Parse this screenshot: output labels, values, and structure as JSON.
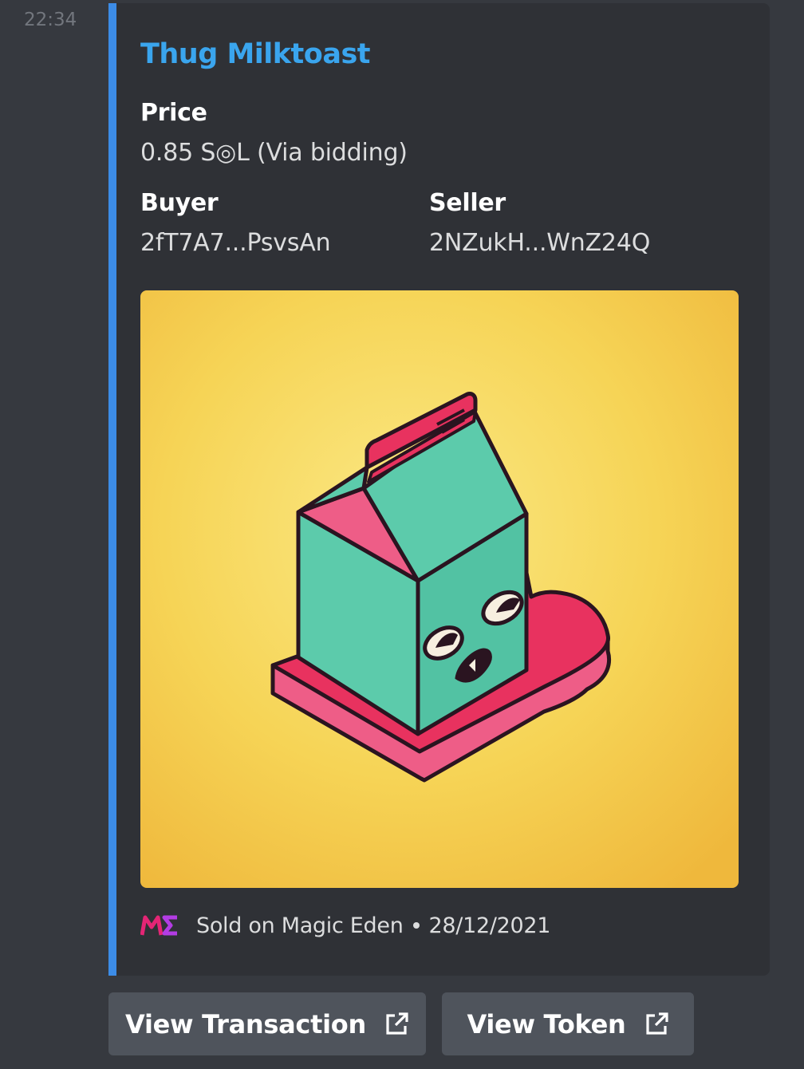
{
  "message": {
    "timestamp": "22:34"
  },
  "embed": {
    "accent_color": "#3c8ce7",
    "title": "Thug Milktoast",
    "title_color": "#3aa5ee",
    "fields": {
      "price": {
        "name": "Price",
        "value": "0.85 S◎L (Via bidding)"
      },
      "buyer": {
        "name": "Buyer",
        "value": "2fT7A7...PsvsAn"
      },
      "seller": {
        "name": "Seller",
        "value": "2NZukH...WnZ24Q"
      }
    },
    "image": {
      "description_icon": "milk-carton-nft-image",
      "background": "#f3c748"
    },
    "footer": {
      "icon": "magic-eden-logo-icon",
      "text": "Sold on Magic Eden",
      "date": "28/12/2021"
    }
  },
  "buttons": {
    "view_transaction": {
      "label": "View Transaction",
      "icon": "external-link-icon"
    },
    "view_token": {
      "label": "View Token",
      "icon": "external-link-icon"
    }
  }
}
